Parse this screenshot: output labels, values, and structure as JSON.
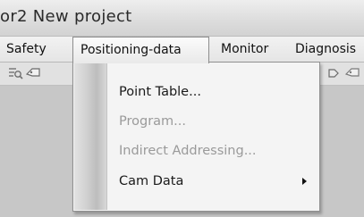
{
  "window": {
    "title": "or2 New project"
  },
  "menubar": {
    "items": [
      {
        "label": "Safety"
      },
      {
        "label": "Positioning-data"
      },
      {
        "label": "Monitor"
      },
      {
        "label": "Diagnosis"
      }
    ]
  },
  "toolbar": {
    "icons": [
      "zoom-list-icon",
      "tag-icon",
      "chevron-icon",
      "tag-icon"
    ]
  },
  "dropdown": {
    "items": [
      {
        "label": "Point Table...",
        "enabled": true,
        "submenu": false
      },
      {
        "label": "Program...",
        "enabled": false,
        "submenu": false
      },
      {
        "label": "Indirect Addressing...",
        "enabled": false,
        "submenu": false
      },
      {
        "label": "Cam Data",
        "enabled": true,
        "submenu": true
      }
    ]
  },
  "colors": {
    "disabled_text": "#9a9a9a",
    "menu_background": "#f4f4f4"
  }
}
